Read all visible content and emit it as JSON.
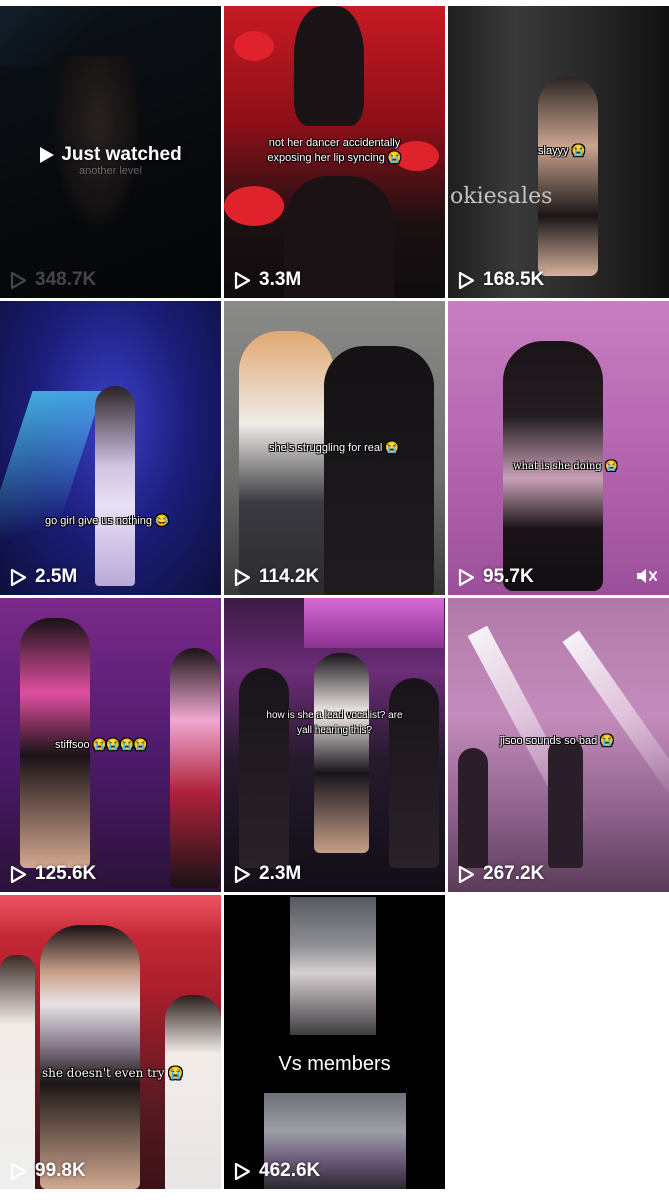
{
  "tiles": [
    {
      "views": "348.7K",
      "caption": "another level",
      "overlay": "Just watched"
    },
    {
      "views": "3.3M",
      "caption": "not her dancer accidentally exposing her lip syncing 😭"
    },
    {
      "views": "168.5K",
      "caption": "slayyy 😭",
      "watermark": "okiesales"
    },
    {
      "views": "2.5M",
      "caption": "go girl give us nothing 😂"
    },
    {
      "views": "114.2K",
      "caption": "she's struggling for real 😭"
    },
    {
      "views": "95.7K",
      "caption": "what is she doing 😭"
    },
    {
      "views": "125.6K",
      "caption": "stiffsoo 😭😭😭😭"
    },
    {
      "views": "2.3M",
      "caption": "how is she a lead vocalist? are yall hearing this?"
    },
    {
      "views": "267.2K",
      "caption": "jisoo sounds so bad 😭"
    },
    {
      "views": "99.8K",
      "caption": "she doesn't even try 😭"
    },
    {
      "views": "462.6K",
      "caption": "Vs members"
    }
  ],
  "icons": {
    "play": "play-icon",
    "mute": "mute-icon"
  }
}
